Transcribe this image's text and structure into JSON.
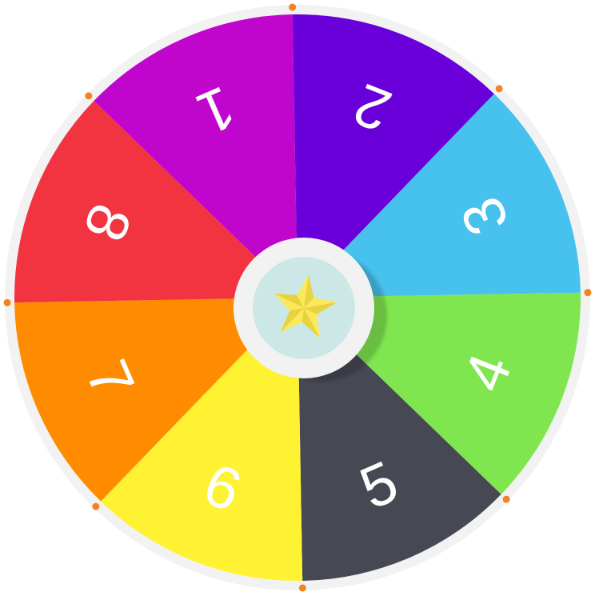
{
  "wheel": {
    "segments": [
      {
        "label": "1",
        "color": "#c006cc"
      },
      {
        "label": "2",
        "color": "#6a00d9"
      },
      {
        "label": "3",
        "color": "#47c1ee"
      },
      {
        "label": "4",
        "color": "#80e64f"
      },
      {
        "label": "5",
        "color": "#464953"
      },
      {
        "label": "6",
        "color": "#fef233"
      },
      {
        "label": "7",
        "color": "#ff8c00"
      },
      {
        "label": "8",
        "color": "#f23440"
      }
    ],
    "rim_color": "#f2f2f2",
    "peg_color": "#f58220",
    "hub": {
      "ring_color": "#f2f2f2",
      "face_color": "#cce8e6",
      "icon": "star-icon",
      "icon_color": "#fbe95a"
    }
  }
}
